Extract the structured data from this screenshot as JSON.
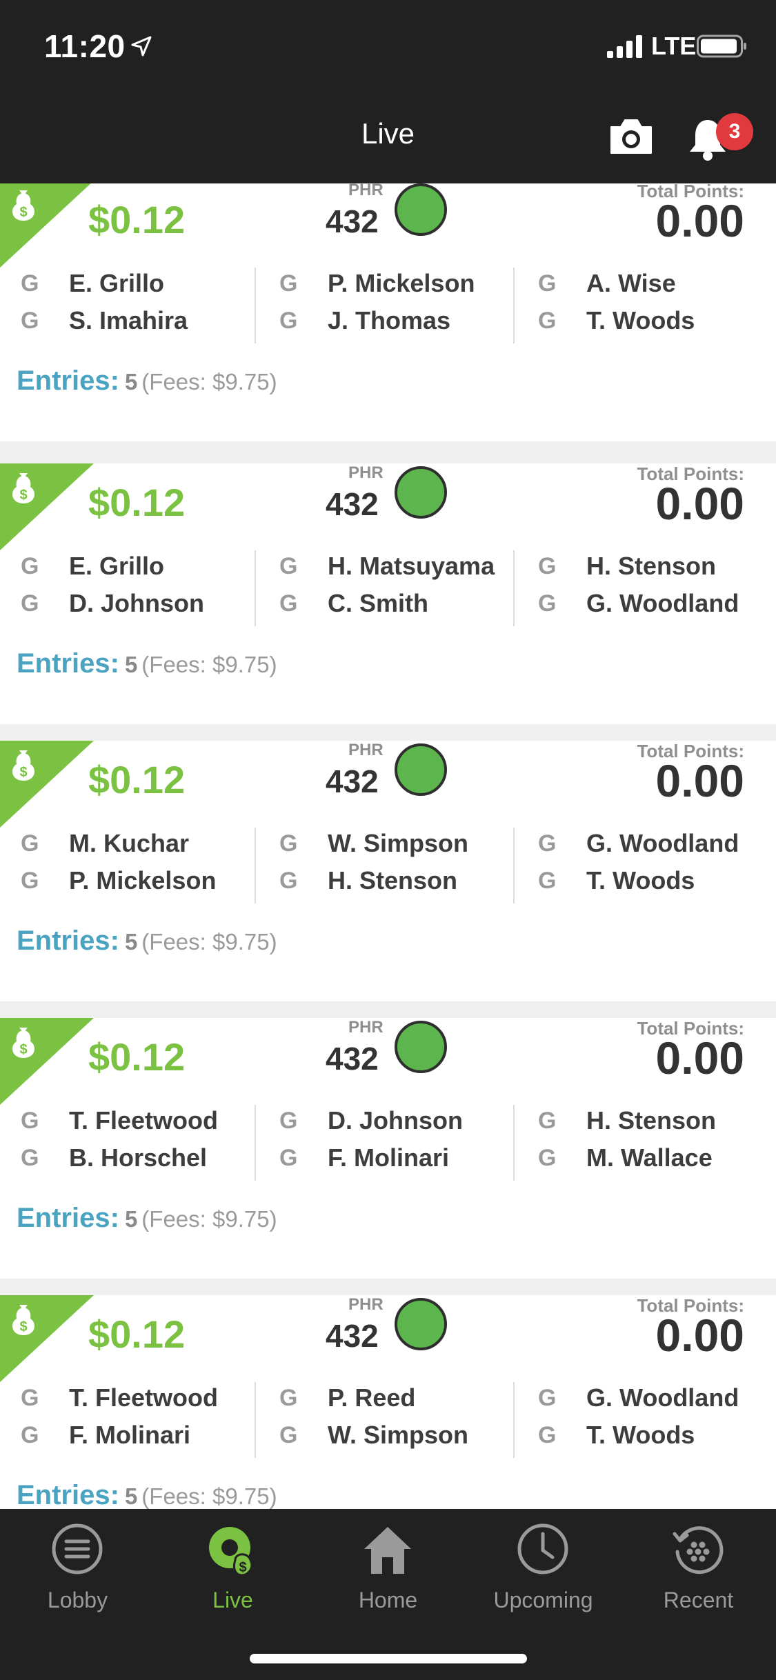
{
  "status_bar": {
    "time": "11:20",
    "network": "LTE"
  },
  "header": {
    "title": "Live",
    "notification_count": "3"
  },
  "cards": [
    {
      "amount": "$0.12",
      "phr_label": "PHR",
      "phr": "432",
      "points_label": "Total Points:",
      "points": "0.00",
      "players": [
        [
          {
            "pos": "G",
            "name": "E. Grillo"
          },
          {
            "pos": "G",
            "name": "S. Imahira"
          }
        ],
        [
          {
            "pos": "G",
            "name": "P. Mickelson"
          },
          {
            "pos": "G",
            "name": "J. Thomas"
          }
        ],
        [
          {
            "pos": "G",
            "name": "A. Wise"
          },
          {
            "pos": "G",
            "name": "T. Woods"
          }
        ]
      ],
      "entries_label": "Entries:",
      "entries": "5",
      "fees": "(Fees: $9.75)"
    },
    {
      "amount": "$0.12",
      "phr_label": "PHR",
      "phr": "432",
      "points_label": "Total Points:",
      "points": "0.00",
      "players": [
        [
          {
            "pos": "G",
            "name": "E. Grillo"
          },
          {
            "pos": "G",
            "name": "D. Johnson"
          }
        ],
        [
          {
            "pos": "G",
            "name": "H. Matsuyama"
          },
          {
            "pos": "G",
            "name": "C. Smith"
          }
        ],
        [
          {
            "pos": "G",
            "name": "H. Stenson"
          },
          {
            "pos": "G",
            "name": "G. Woodland"
          }
        ]
      ],
      "entries_label": "Entries:",
      "entries": "5",
      "fees": "(Fees: $9.75)"
    },
    {
      "amount": "$0.12",
      "phr_label": "PHR",
      "phr": "432",
      "points_label": "Total Points:",
      "points": "0.00",
      "players": [
        [
          {
            "pos": "G",
            "name": "M. Kuchar"
          },
          {
            "pos": "G",
            "name": "P. Mickelson"
          }
        ],
        [
          {
            "pos": "G",
            "name": "W. Simpson"
          },
          {
            "pos": "G",
            "name": "H. Stenson"
          }
        ],
        [
          {
            "pos": "G",
            "name": "G. Woodland"
          },
          {
            "pos": "G",
            "name": "T. Woods"
          }
        ]
      ],
      "entries_label": "Entries:",
      "entries": "5",
      "fees": "(Fees: $9.75)"
    },
    {
      "amount": "$0.12",
      "phr_label": "PHR",
      "phr": "432",
      "points_label": "Total Points:",
      "points": "0.00",
      "players": [
        [
          {
            "pos": "G",
            "name": "T. Fleetwood"
          },
          {
            "pos": "G",
            "name": "B. Horschel"
          }
        ],
        [
          {
            "pos": "G",
            "name": "D. Johnson"
          },
          {
            "pos": "G",
            "name": "F. Molinari"
          }
        ],
        [
          {
            "pos": "G",
            "name": "H. Stenson"
          },
          {
            "pos": "G",
            "name": "M. Wallace"
          }
        ]
      ],
      "entries_label": "Entries:",
      "entries": "5",
      "fees": "(Fees: $9.75)"
    },
    {
      "amount": "$0.12",
      "phr_label": "PHR",
      "phr": "432",
      "points_label": "Total Points:",
      "points": "0.00",
      "players": [
        [
          {
            "pos": "G",
            "name": "T. Fleetwood"
          },
          {
            "pos": "G",
            "name": "F. Molinari"
          }
        ],
        [
          {
            "pos": "G",
            "name": "P. Reed"
          },
          {
            "pos": "G",
            "name": "W. Simpson"
          }
        ],
        [
          {
            "pos": "G",
            "name": "G. Woodland"
          },
          {
            "pos": "G",
            "name": "T. Woods"
          }
        ]
      ],
      "entries_label": "Entries:",
      "entries": "5",
      "fees": "(Fees: $9.75)"
    }
  ],
  "tabs": [
    {
      "label": "Lobby",
      "icon": "menu-icon",
      "active": false
    },
    {
      "label": "Live",
      "icon": "live-money-icon",
      "active": true
    },
    {
      "label": "Home",
      "icon": "home-icon",
      "active": false
    },
    {
      "label": "Upcoming",
      "icon": "clock-icon",
      "active": false
    },
    {
      "label": "Recent",
      "icon": "history-icon",
      "active": false
    }
  ],
  "colors": {
    "accent_green": "#7cc242",
    "entries_blue": "#4aa3c0",
    "status_green": "#5db54d",
    "badge_red": "#e0393e",
    "bar_dark": "#212121"
  }
}
